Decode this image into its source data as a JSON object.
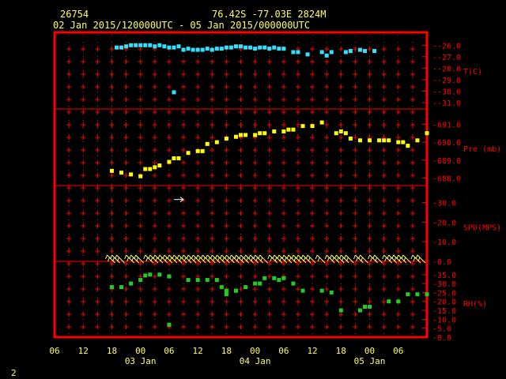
{
  "header": {
    "station_id": "26754",
    "location": "76.42S   -77.03E   2824M",
    "period": "02 Jan 2015/120000UTC - 05 Jan 2015/000000UTC"
  },
  "footer": {
    "page_number": "2"
  },
  "colors": {
    "background": "#000000",
    "frame": "#ff0000",
    "text": "#ffff66",
    "temperature": "#33e0ff",
    "pressure": "#ffff00",
    "wind": "#ffff66",
    "humidity": "#22cc22"
  },
  "chart_data": [
    {
      "type": "scatter",
      "panel": "temperature",
      "ylabel": "T(C)",
      "ylim": [
        -31.0,
        -25.5
      ],
      "yticks": [
        "-26.0",
        "-27.0",
        "-28.0",
        "-29.0",
        "-30.0",
        "-31.0"
      ],
      "x": [
        13,
        14,
        15,
        16,
        17,
        18,
        19,
        20,
        21,
        22,
        23,
        24,
        25,
        26,
        27,
        28,
        29,
        30,
        31,
        32,
        33,
        34,
        35,
        36,
        37,
        38,
        39,
        40,
        41,
        42,
        43,
        44,
        45,
        46,
        47,
        48,
        50,
        51,
        53,
        56,
        57,
        58,
        61,
        62,
        64,
        65,
        67
      ],
      "values": [
        -26.2,
        -26.2,
        -26.1,
        -26.0,
        -26.0,
        -26.0,
        -26.0,
        -26.0,
        -26.1,
        -26.0,
        -26.1,
        -26.2,
        -26.2,
        -26.1,
        -26.4,
        -26.3,
        -26.4,
        -26.4,
        -26.4,
        -26.3,
        -26.4,
        -26.3,
        -26.3,
        -26.2,
        -26.2,
        -26.1,
        -26.1,
        -26.2,
        -26.2,
        -26.3,
        -26.2,
        -26.2,
        -26.3,
        -26.2,
        -26.3,
        -26.3,
        -26.6,
        -26.6,
        -26.8,
        -26.6,
        -26.9,
        -26.6,
        -26.6,
        -26.5,
        -26.4,
        -26.5,
        -26.5
      ],
      "outliers": [
        {
          "x": 25,
          "value": -30.1
        }
      ]
    },
    {
      "type": "scatter",
      "panel": "pressure",
      "ylabel": "Pre (mb)",
      "ylim": [
        687.8,
        691.5
      ],
      "yticks": [
        "691.0",
        "690.0",
        "689.0",
        "688.0"
      ],
      "x": [
        12,
        14,
        16,
        18,
        19,
        20,
        21,
        22,
        24,
        25,
        26,
        28,
        30,
        31,
        32,
        34,
        36,
        38,
        39,
        40,
        42,
        43,
        44,
        46,
        48,
        49,
        50,
        52,
        54,
        56,
        59,
        60,
        61,
        62,
        64,
        66,
        68,
        69,
        70,
        72,
        73,
        74,
        76,
        78
      ],
      "values": [
        688.4,
        688.3,
        688.2,
        688.1,
        688.5,
        688.5,
        688.6,
        688.7,
        688.9,
        689.1,
        689.1,
        689.4,
        689.5,
        689.5,
        689.9,
        690.0,
        690.2,
        690.3,
        690.4,
        690.4,
        690.4,
        690.5,
        690.5,
        690.6,
        690.6,
        690.7,
        690.7,
        690.9,
        690.9,
        691.1,
        690.5,
        690.6,
        690.5,
        690.2,
        690.1,
        690.1,
        690.1,
        690.1,
        690.1,
        690.0,
        690.0,
        689.8,
        690.1,
        690.5
      ]
    },
    {
      "type": "scatter",
      "panel": "wind_speed",
      "ylabel": "SPD(MPS)",
      "ylim": [
        0.0,
        35.0
      ],
      "yticks": [
        "30.0",
        "20.0",
        "10.0",
        "0.0"
      ],
      "arrow_marker": {
        "x": 25,
        "value": 31.5
      },
      "barb_x": [
        12,
        13,
        14,
        16,
        17,
        18,
        20,
        21,
        22,
        23,
        24,
        25,
        26,
        27,
        28,
        29,
        30,
        31,
        32,
        33,
        34,
        35,
        36,
        37,
        38,
        39,
        40,
        41,
        42,
        43,
        44,
        46,
        47,
        48,
        49,
        50,
        51,
        52,
        53,
        54,
        56,
        58,
        59,
        60,
        61,
        62,
        64,
        65,
        67,
        68,
        70,
        71,
        72,
        73,
        74,
        76,
        77
      ]
    },
    {
      "type": "scatter",
      "panel": "relative_humidity",
      "ylabel": "RH(%)",
      "ylim": [
        0.0,
        38.0
      ],
      "yticks": [
        "35.0",
        "30.0",
        "25.0",
        "20.0",
        "15.0",
        "10.0",
        "5.0",
        "0.0"
      ],
      "x": [
        12,
        14,
        16,
        18,
        19,
        20,
        22,
        24,
        28,
        30,
        32,
        34,
        35,
        36,
        36,
        38,
        38,
        40,
        42,
        43,
        44,
        46,
        47,
        48,
        50,
        52,
        56,
        58,
        60,
        64,
        65,
        66,
        70,
        72,
        74,
        76,
        78
      ],
      "values": [
        28.0,
        28.0,
        30.0,
        32.0,
        34.5,
        35.0,
        35.0,
        34.0,
        32.0,
        32.0,
        32.0,
        32.0,
        28.0,
        24.0,
        26.0,
        26.0,
        26.0,
        28.0,
        30.0,
        30.0,
        33.0,
        33.0,
        32.0,
        33.0,
        30.0,
        26.0,
        26.0,
        25.0,
        15.0,
        15.0,
        17.0,
        17.0,
        20.0,
        20.0,
        24.0,
        24.0,
        24.0
      ],
      "outliers": [
        {
          "x": 24,
          "value": 7.0
        }
      ]
    }
  ],
  "x_axis": {
    "range_hours": [
      0,
      78
    ],
    "tick_labels": [
      "06",
      "12",
      "18",
      "00",
      "06",
      "12",
      "18",
      "00",
      "06",
      "12",
      "18",
      "00",
      "06"
    ],
    "date_labels": [
      "03 Jan",
      "04 Jan",
      "05 Jan"
    ]
  }
}
